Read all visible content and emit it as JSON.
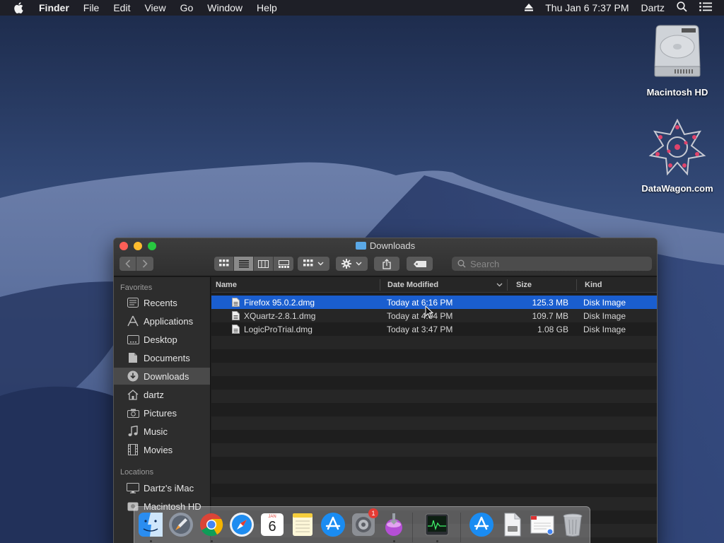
{
  "menubar": {
    "app": "Finder",
    "items": [
      "File",
      "Edit",
      "View",
      "Go",
      "Window",
      "Help"
    ],
    "clock": "Thu Jan 6  7:37 PM",
    "user": "Dartz"
  },
  "desktop": {
    "icons": [
      {
        "label": "Macintosh HD",
        "icon": "hard-drive-icon"
      },
      {
        "label": "DataWagon.com",
        "icon": "datawagon-logo-icon"
      }
    ]
  },
  "window": {
    "title": "Downloads",
    "search_placeholder": "Search"
  },
  "sidebar": {
    "favorites_header": "Favorites",
    "favorites": [
      {
        "label": "Recents",
        "icon": "clock-icon"
      },
      {
        "label": "Applications",
        "icon": "applications-icon"
      },
      {
        "label": "Desktop",
        "icon": "desktop-icon"
      },
      {
        "label": "Documents",
        "icon": "document-icon"
      },
      {
        "label": "Downloads",
        "icon": "download-icon",
        "selected": true
      },
      {
        "label": "dartz",
        "icon": "home-icon"
      },
      {
        "label": "Pictures",
        "icon": "camera-icon"
      },
      {
        "label": "Music",
        "icon": "music-note-icon"
      },
      {
        "label": "Movies",
        "icon": "film-icon"
      }
    ],
    "locations_header": "Locations",
    "locations": [
      {
        "label": "Dartz's iMac",
        "icon": "imac-icon"
      },
      {
        "label": "Macintosh HD",
        "icon": "hard-drive-icon"
      }
    ]
  },
  "columns": {
    "name": "Name",
    "date": "Date Modified",
    "size": "Size",
    "kind": "Kind"
  },
  "files": [
    {
      "name": "Firefox 95.0.2.dmg",
      "date": "Today at 6:16 PM",
      "size": "125.3 MB",
      "kind": "Disk Image",
      "selected": true
    },
    {
      "name": "XQuartz-2.8.1.dmg",
      "date": "Today at 4:04 PM",
      "size": "109.7 MB",
      "kind": "Disk Image"
    },
    {
      "name": "LogicProTrial.dmg",
      "date": "Today at 3:47 PM",
      "size": "1.08 GB",
      "kind": "Disk Image"
    }
  ],
  "dock": {
    "apps": [
      "finder-icon",
      "launchpad-icon",
      "chrome-icon",
      "safari-icon",
      "calendar-icon",
      "notes-icon",
      "app-store-icon",
      "system-preferences-icon",
      "installer-icon",
      "activity-monitor-icon",
      "app-store-downloads-icon",
      "file-icon",
      "preview-document-icon",
      "trash-icon"
    ],
    "calendar_month": "JAN",
    "calendar_day": "6",
    "prefs_badge": "1"
  },
  "colors": {
    "selection": "#1a5ecf",
    "accent_blue": "#5aa8e6"
  }
}
